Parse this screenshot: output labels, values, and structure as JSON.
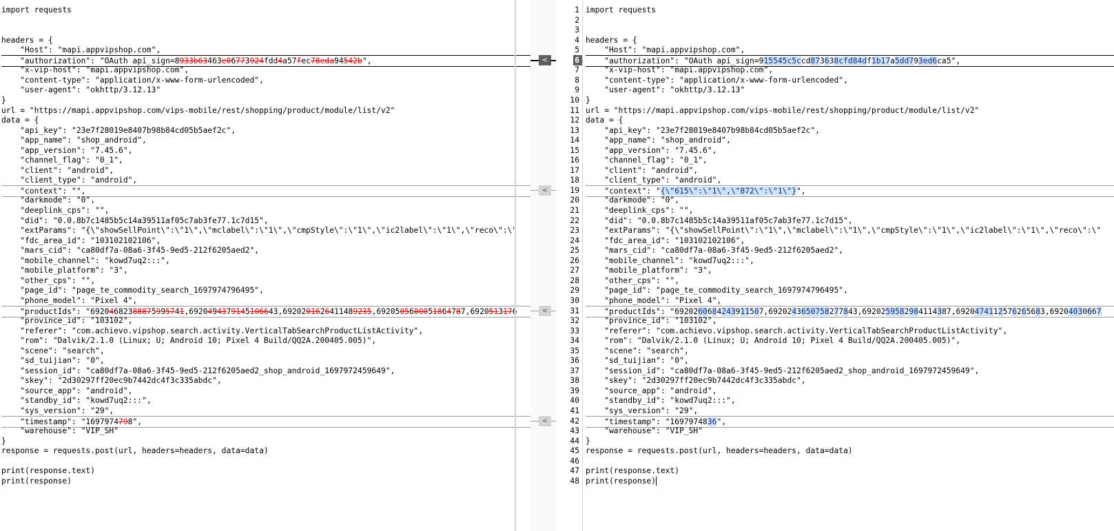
{
  "left": {
    "lines": [
      [
        {
          "t": "import requests"
        }
      ],
      [],
      [],
      [
        {
          "t": "headers = {"
        }
      ],
      [
        {
          "t": "    \"Host\": \"mapi.appvipshop.com\","
        }
      ],
      [
        {
          "t": "    \"authorization\": \"OAuth api_sign=8"
        },
        {
          "t": "93",
          "c": "del"
        },
        {
          "t": "3b63",
          "c": "del"
        },
        {
          "t": "4"
        },
        {
          "t": "63"
        },
        {
          "t": "e0",
          "c": "del"
        },
        {
          "t": "6"
        },
        {
          "t": "77",
          "c": "del"
        },
        {
          "t": "3"
        },
        {
          "t": "924",
          "c": "del"
        },
        {
          "t": "fdd"
        },
        {
          "t": "4",
          "c": "del"
        },
        {
          "t": "a57"
        },
        {
          "t": "f",
          "c": "del"
        },
        {
          "t": "ec"
        },
        {
          "t": "78eda",
          "c": "del"
        },
        {
          "t": "94"
        },
        {
          "t": "542b",
          "c": "del"
        },
        {
          "t": "\","
        }
      ],
      [
        {
          "t": "    \"x-vip-host\": \"mapi.appvipshop.com\","
        }
      ],
      [
        {
          "t": "    \"content-type\": \"application/x-www-form-urlencoded\","
        }
      ],
      [
        {
          "t": "    \"user-agent\": \"okhttp/3.12.13\""
        }
      ],
      [
        {
          "t": "}"
        }
      ],
      [
        {
          "t": "url = \"https://mapi.appvipshop.com/vips-mobile/rest/shopping/product/module/list/v2\""
        }
      ],
      [
        {
          "t": "data = {"
        }
      ],
      [
        {
          "t": "    \"api_key\": \"23e7f28019e8407b98b84cd05b5aef2c\","
        }
      ],
      [
        {
          "t": "    \"app_name\": \"shop_android\","
        }
      ],
      [
        {
          "t": "    \"app_version\": \"7.45.6\","
        }
      ],
      [
        {
          "t": "    \"channel_flag\": \"0_1\","
        }
      ],
      [
        {
          "t": "    \"client\": \"android\","
        }
      ],
      [
        {
          "t": "    \"client_type\": \"android\","
        }
      ],
      [
        {
          "t": "    \"context\": \"\","
        }
      ],
      [
        {
          "t": "    \"darkmode\": \"0\","
        }
      ],
      [
        {
          "t": "    \"deeplink_cps\": \"\","
        }
      ],
      [
        {
          "t": "    \"did\": \"0.0.8b7c1485b5c14a39511af05c7ab3fe77.1c7d15\","
        }
      ],
      [
        {
          "t": "    \"extParams\": \"{\\\"showSellPoint\\\":\\\"1\\\",\\\"mclabel\\\":\\\"1\\\",\\\"cmpStyle\\\":\\\"1\\\",\\\"ic2label\\\":\\\"1\\\",\\\"reco\\\":\\\""
        }
      ],
      [
        {
          "t": "    \"fdc_area_id\": \"103102102106\","
        }
      ],
      [
        {
          "t": "    \"mars_cid\": \"ca80df7a-08a6-3f45-9ed5-212f6205aed2\","
        }
      ],
      [
        {
          "t": "    \"mobile_channel\": \"kowd7uq2:::\","
        }
      ],
      [
        {
          "t": "    \"mobile_platform\": \"3\","
        }
      ],
      [
        {
          "t": "    \"other_cps\": \"\","
        }
      ],
      [
        {
          "t": "    \"page_id\": \"page_te_commodity_search_1697974796495\","
        }
      ],
      [
        {
          "t": "    \"phone_model\": \"Pixel 4\","
        }
      ],
      [
        {
          "t": "    \"productIds\": \"6920"
        },
        {
          "t": "4",
          "c": "del"
        },
        {
          "t": "6823"
        },
        {
          "t": "8887",
          "c": "del"
        },
        {
          "t": "5"
        },
        {
          "t": "9",
          "c": "del"
        },
        {
          "t": "9"
        },
        {
          "t": "57",
          "c": "del"
        },
        {
          "t": "4"
        },
        {
          "t": "1",
          "c": "del"
        },
        {
          "t": ",6920"
        },
        {
          "t": "4",
          "c": "del"
        },
        {
          "t": "9"
        },
        {
          "t": "43",
          "c": "del"
        },
        {
          "t": "7"
        },
        {
          "t": "914",
          "c": "del"
        },
        {
          "t": "5"
        },
        {
          "t": "1066",
          "c": "del"
        },
        {
          "t": "43,69202"
        },
        {
          "t": "016",
          "c": "del"
        },
        {
          "t": "2"
        },
        {
          "t": "6",
          "c": "del"
        },
        {
          "t": "41148"
        },
        {
          "t": "9235",
          "c": "del"
        },
        {
          "t": ",69205"
        },
        {
          "t": "05",
          "c": "del"
        },
        {
          "t": "6"
        },
        {
          "t": "000",
          "c": "del"
        },
        {
          "t": "5"
        },
        {
          "t": "18",
          "c": "del"
        },
        {
          "t": "6"
        },
        {
          "t": "4",
          "c": "del"
        },
        {
          "t": "7"
        },
        {
          "t": "8",
          "c": "del"
        },
        {
          "t": "7,6920"
        },
        {
          "t": "51",
          "c": "del"
        },
        {
          "t": "3"
        },
        {
          "t": "17",
          "c": "del"
        },
        {
          "t": "6"
        }
      ],
      [
        {
          "t": "    \"province_id\": \"103102\","
        }
      ],
      [
        {
          "t": "    \"referer\": \"com.achievo.vipshop.search.activity.VerticalTabSearchProductListActivity\","
        }
      ],
      [
        {
          "t": "    \"rom\": \"Dalvik/2.1.0 (Linux; U; Android 10; Pixel 4 Build/QQ2A.200405.005)\","
        }
      ],
      [
        {
          "t": "    \"scene\": \"search\","
        }
      ],
      [
        {
          "t": "    \"sd_tuijian\": \"0\","
        }
      ],
      [
        {
          "t": "    \"session_id\": \"ca80df7a-08a6-3f45-9ed5-212f6205aed2_shop_android_1697972459649\","
        }
      ],
      [
        {
          "t": "    \"skey\": \"2d30297ff20ec9b7442dc4f3c335abdc\","
        }
      ],
      [
        {
          "t": "    \"source_app\": \"android\","
        }
      ],
      [
        {
          "t": "    \"standby_id\": \"kowd7uq2:::\","
        }
      ],
      [
        {
          "t": "    \"sys_version\": \"29\","
        }
      ],
      [
        {
          "t": "    \"timestamp\": \"1697974"
        },
        {
          "t": "79",
          "c": "del"
        },
        {
          "t": "8\","
        }
      ],
      [
        {
          "t": "    \"warehouse\": \"VIP_SH\""
        }
      ],
      [
        {
          "t": "}"
        }
      ],
      [
        {
          "t": "response = requests.post(url, headers=headers, data=data)"
        }
      ],
      [],
      [
        {
          "t": "print(response.text)"
        }
      ],
      [
        {
          "t": "print(response)"
        }
      ]
    ]
  },
  "right": {
    "line_numbers": [
      "1",
      "2",
      "3",
      "4",
      "5",
      "6",
      "7",
      "8",
      "9",
      "10",
      "11",
      "12",
      "13",
      "14",
      "15",
      "16",
      "17",
      "18",
      "19",
      "20",
      "21",
      "22",
      "23",
      "24",
      "25",
      "26",
      "27",
      "28",
      "29",
      "30",
      "31",
      "32",
      "33",
      "34",
      "35",
      "36",
      "37",
      "38",
      "39",
      "40",
      "41",
      "42",
      "43",
      "44",
      "45",
      "46",
      "47",
      "48"
    ],
    "lines": [
      [
        {
          "t": "import requests"
        }
      ],
      [],
      [],
      [
        {
          "t": "headers = {"
        }
      ],
      [
        {
          "t": "    \"Host\": \"mapi.appvipshop.com\","
        }
      ],
      [
        {
          "t": "    \"authorization\": \"OAuth api_sign=9"
        },
        {
          "t": "15545c5c",
          "c": "ins"
        },
        {
          "t": "cd"
        },
        {
          "t": "87",
          "c": "ins"
        },
        {
          "t": "3"
        },
        {
          "t": "6",
          "c": "ins"
        },
        {
          "t": "3"
        },
        {
          "t": "8cfd84d",
          "c": "ins"
        },
        {
          "t": "f"
        },
        {
          "t": "1b17",
          "c": "ins"
        },
        {
          "t": "a"
        },
        {
          "t": "5dd7",
          "c": "ins"
        },
        {
          "t": "9"
        },
        {
          "t": "3ed6",
          "c": "ins"
        },
        {
          "t": "ca5\","
        }
      ],
      [
        {
          "t": "    \"x-vip-host\": \"mapi.appvipshop.com\","
        }
      ],
      [
        {
          "t": "    \"content-type\": \"application/x-www-form-urlencoded\","
        }
      ],
      [
        {
          "t": "    \"user-agent\": \"okhttp/3.12.13\""
        }
      ],
      [
        {
          "t": "}"
        }
      ],
      [
        {
          "t": "url = \"https://mapi.appvipshop.com/vips-mobile/rest/shopping/product/module/list/v2\""
        }
      ],
      [
        {
          "t": "data = {"
        }
      ],
      [
        {
          "t": "    \"api_key\": \"23e7f28019e8407b98b84cd05b5aef2c\","
        }
      ],
      [
        {
          "t": "    \"app_name\": \"shop_android\","
        }
      ],
      [
        {
          "t": "    \"app_version\": \"7.45.6\","
        }
      ],
      [
        {
          "t": "    \"channel_flag\": \"0_1\","
        }
      ],
      [
        {
          "t": "    \"client\": \"android\","
        }
      ],
      [
        {
          "t": "    \"client_type\": \"android\","
        }
      ],
      [
        {
          "t": "    \"context\": \""
        },
        {
          "t": "{\\\"615\\\":\\\"1\\\",\\\"872\\\":\\\"1\\\"}",
          "c": "ins"
        },
        {
          "t": "\","
        }
      ],
      [
        {
          "t": "    \"darkmode\": \"0\","
        }
      ],
      [
        {
          "t": "    \"deeplink_cps\": \"\","
        }
      ],
      [
        {
          "t": "    \"did\": \"0.0.8b7c1485b5c14a39511af05c7ab3fe77.1c7d15\","
        }
      ],
      [
        {
          "t": "    \"extParams\": \"{\\\"showSellPoint\\\":\\\"1\\\",\\\"mclabel\\\":\\\"1\\\",\\\"cmpStyle\\\":\\\"1\\\",\\\"ic2label\\\":\\\"1\\\",\\\"reco\\\":\\\""
        }
      ],
      [
        {
          "t": "    \"fdc_area_id\": \"103102102106\","
        }
      ],
      [
        {
          "t": "    \"mars_cid\": \"ca80df7a-08a6-3f45-9ed5-212f6205aed2\","
        }
      ],
      [
        {
          "t": "    \"mobile_channel\": \"kowd7uq2:::\","
        }
      ],
      [
        {
          "t": "    \"mobile_platform\": \"3\","
        }
      ],
      [
        {
          "t": "    \"other_cps\": \"\","
        }
      ],
      [
        {
          "t": "    \"page_id\": \"page_te_commodity_search_1697974796495\","
        }
      ],
      [
        {
          "t": "    \"phone_model\": \"Pixel 4\","
        }
      ],
      [
        {
          "t": "    \"productIds\": \"69202"
        },
        {
          "t": "60",
          "c": "ins"
        },
        {
          "t": "6"
        },
        {
          "t": "8",
          "c": "ins"
        },
        {
          "t": "4"
        },
        {
          "t": "243",
          "c": "ins"
        },
        {
          "t": "9"
        },
        {
          "t": "11",
          "c": "ins"
        },
        {
          "t": "5"
        },
        {
          "t": "0",
          "c": "ins"
        },
        {
          "t": "7,69202"
        },
        {
          "t": "4",
          "c": "ins"
        },
        {
          "t": "3"
        },
        {
          "t": "650758",
          "c": "ins"
        },
        {
          "t": "2"
        },
        {
          "t": "7",
          "c": "ins"
        },
        {
          "t": "7"
        },
        {
          "t": "8",
          "c": "ins"
        },
        {
          "t": "43,69202"
        },
        {
          "t": "5958",
          "c": "ins"
        },
        {
          "t": "2"
        },
        {
          "t": "98",
          "c": "ins"
        },
        {
          "t": "4114"
        },
        {
          "t": "3",
          "c": "ins"
        },
        {
          "t": "87,6920"
        },
        {
          "t": "4741",
          "c": "ins"
        },
        {
          "t": "1"
        },
        {
          "t": "2",
          "c": "ins"
        },
        {
          "t": "57"
        },
        {
          "t": "6",
          "c": "ins"
        },
        {
          "t": "2"
        },
        {
          "t": "6",
          "c": "ins"
        },
        {
          "t": "56"
        },
        {
          "t": "8",
          "c": "ins"
        },
        {
          "t": "3,6920"
        },
        {
          "t": "403",
          "c": "ins"
        },
        {
          "t": "0"
        },
        {
          "t": "6",
          "c": "ins"
        },
        {
          "t": "6"
        },
        {
          "t": "7",
          "c": "ins"
        }
      ],
      [
        {
          "t": "    \"province_id\": \"103102\","
        }
      ],
      [
        {
          "t": "    \"referer\": \"com.achievo.vipshop.search.activity.VerticalTabSearchProductListActivity\","
        }
      ],
      [
        {
          "t": "    \"rom\": \"Dalvik/2.1.0 (Linux; U; Android 10; Pixel 4 Build/QQ2A.200405.005)\","
        }
      ],
      [
        {
          "t": "    \"scene\": \"search\","
        }
      ],
      [
        {
          "t": "    \"sd_tuijian\": \"0\","
        }
      ],
      [
        {
          "t": "    \"session_id\": \"ca80df7a-08a6-3f45-9ed5-212f6205aed2_shop_android_1697972459649\","
        }
      ],
      [
        {
          "t": "    \"skey\": \"2d30297ff20ec9b7442dc4f3c335abdc\","
        }
      ],
      [
        {
          "t": "    \"source_app\": \"android\","
        }
      ],
      [
        {
          "t": "    \"standby_id\": \"kowd7uq2:::\","
        }
      ],
      [
        {
          "t": "    \"sys_version\": \"29\","
        }
      ],
      [
        {
          "t": "    \"timestamp\": \"1697974"
        },
        {
          "t": "8"
        },
        {
          "t": "36",
          "c": "ins"
        },
        {
          "t": "\","
        }
      ],
      [
        {
          "t": "    \"warehouse\": \"VIP_SH\""
        }
      ],
      [
        {
          "t": "}"
        }
      ],
      [
        {
          "t": "response = requests.post(url, headers=headers, data=data)"
        }
      ],
      [],
      [
        {
          "t": "print(response.text)"
        }
      ],
      [
        {
          "t": "print(response)"
        }
      ]
    ]
  },
  "diff": {
    "changed_lines": [
      6,
      19,
      31,
      42
    ],
    "current_line": 6,
    "copy_arrow": "<"
  }
}
